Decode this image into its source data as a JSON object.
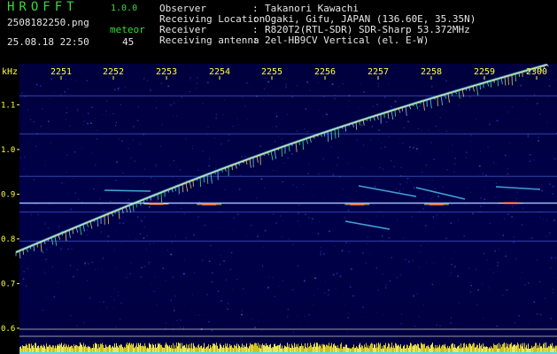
{
  "header": {
    "logo": "HROFFT",
    "version": "1.0.0",
    "filename": "2508182250.png",
    "meteor_label": "meteor",
    "datetime": "25.08.18 22:50",
    "meteor_count": "45"
  },
  "info": [
    {
      "key": "Observer",
      "value": "Takanori Kawachi"
    },
    {
      "key": "Receiving Location",
      "value": "Ogaki, Gifu, JAPAN (136.60E, 35.35N)"
    },
    {
      "key": "Receiver",
      "value": "R820T2(RTL-SDR) SDR-Sharp 53.372MHz"
    },
    {
      "key": "Receiving antenna",
      "value": "2el-HB9CV Vertical (el. E-W)"
    }
  ],
  "colors": {
    "background": "#00003c",
    "header_text": "#39d93a",
    "info_text": "#e6e6e6",
    "axis_text": "#ffff40",
    "trace_low": "#ffffff",
    "trace_high": "#ff3030"
  },
  "chart_data": {
    "type": "heatmap",
    "ylabel": "kHz",
    "x_ticks": [
      "2251",
      "2252",
      "2253",
      "2254",
      "2255",
      "2256",
      "2257",
      "2258",
      "2259",
      "2300"
    ],
    "y_ticks": [
      "1.1",
      "1.0",
      "0.9",
      "0.8",
      "0.7",
      "0.6"
    ],
    "y_range": [
      0.59,
      1.17
    ],
    "horizontal_lines_khz": [
      1.12,
      1.035,
      0.94,
      0.88,
      0.86,
      0.795
    ],
    "drifting_signal": {
      "time_range": [
        "2250",
        "2300"
      ],
      "start_khz": 0.77,
      "end_khz": 1.19
    },
    "meteor_streaks": [
      {
        "time": "2258.1",
        "khz": 0.877
      },
      {
        "time": "2259.5",
        "khz": 0.88
      },
      {
        "time": "2253.8",
        "khz": 0.877
      },
      {
        "time": "2256.6",
        "khz": 0.877
      },
      {
        "time": "2252.8",
        "khz": 0.878
      }
    ]
  }
}
